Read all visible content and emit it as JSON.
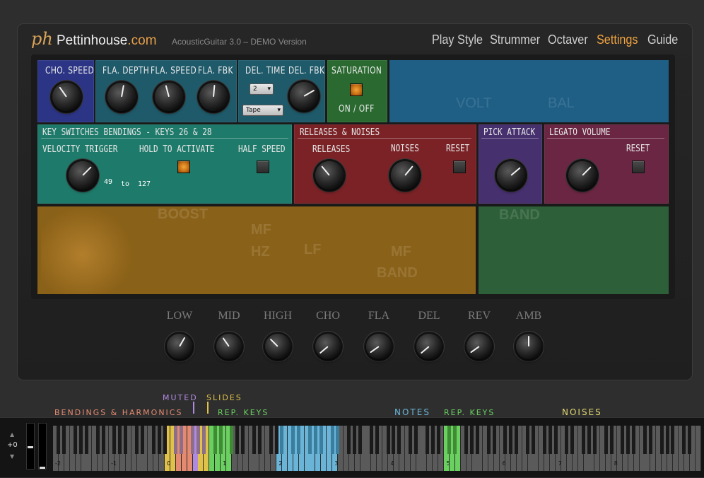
{
  "header": {
    "logo_mark": "ph",
    "brand_name": "Pettinhouse",
    "brand_domain": ".com",
    "product": "AcousticGuitar 3.0 – DEMO Version",
    "tabs": [
      {
        "label": "Play Style",
        "active": false
      },
      {
        "label": "Strummer",
        "active": false
      },
      {
        "label": "Octaver",
        "active": false
      },
      {
        "label": "Settings",
        "active": true
      },
      {
        "label": "Guide",
        "active": false
      }
    ],
    "accent_color": "#f0a340"
  },
  "settings": {
    "chorus": {
      "speed_label": "CHO. SPEED",
      "color": "#2c3585"
    },
    "flanger": {
      "depth_label": "FLA. DEPTH",
      "speed_label": "FLA. SPEED",
      "fbk_label": "FLA. FBK",
      "color": "#1e5a6a"
    },
    "delay": {
      "time_label": "DEL. TIME",
      "fbk_label": "DEL. FBK",
      "time_value": "2",
      "type_value": "Tape",
      "color": "#1e5a6a"
    },
    "saturation": {
      "title": "SATURATION",
      "toggle_label": "ON / OFF",
      "on": true,
      "color": "#2a6a30"
    },
    "reverb_area": {
      "color": "#1f5f86",
      "faded_labels": [
        "VOLT",
        "BAL"
      ]
    },
    "key_switches": {
      "title": "KEY SWITCHES BENDINGS - KEYS 26 & 28",
      "velocity_label": "VELOCITY TRIGGER",
      "hold_label": "HOLD TO ACTIVATE",
      "half_speed_label": "HALF SPEED",
      "range_low": "49",
      "range_sep": "to",
      "range_high": "127",
      "hold_on": true,
      "half_speed_on": false,
      "color": "#1e7a6a"
    },
    "releases_noises": {
      "title": "RELEASES & NOISES",
      "releases_label": "RELEASES",
      "noises_label": "NOISES",
      "reset_label": "RESET",
      "color": "#7a2226"
    },
    "pick_attack": {
      "title": "PICK ATTACK",
      "color": "#46306e"
    },
    "legato_volume": {
      "title": "LEGATO VOLUME",
      "reset_label": "RESET",
      "color": "#6a2642"
    },
    "eq_area": {
      "color": "#8a6118",
      "faded_labels": [
        "BOOST",
        "MF",
        "HZ",
        "LF",
        "MF",
        "BAND"
      ]
    },
    "band_area": {
      "color": "#2d6038",
      "faded_labels": [
        "BAND"
      ]
    }
  },
  "mixer": {
    "knobs": [
      "LOW",
      "MID",
      "HIGH",
      "CHO",
      "FLA",
      "DEL",
      "REV",
      "AMB"
    ]
  },
  "keyboard": {
    "categories": {
      "muted": {
        "label": "MUTED",
        "color": "#b08ae0"
      },
      "slides": {
        "label": "SLIDES",
        "color": "#e0c24a"
      },
      "bendings": {
        "label": "BENDINGS & HARMONICS",
        "color": "#e48a70"
      },
      "rep_keys_1": {
        "label": "REP. KEYS",
        "color": "#6ad060"
      },
      "notes": {
        "label": "NOTES",
        "color": "#6ab4d8"
      },
      "rep_keys_2": {
        "label": "REP. KEYS",
        "color": "#6ad060"
      },
      "noises": {
        "label": "NOISES",
        "color": "#e0d870"
      }
    },
    "transpose": "+0",
    "octave_labels": [
      "-2",
      "-1",
      "0",
      "1",
      "2",
      "3",
      "4",
      "5",
      "6",
      "7",
      "8"
    ]
  }
}
